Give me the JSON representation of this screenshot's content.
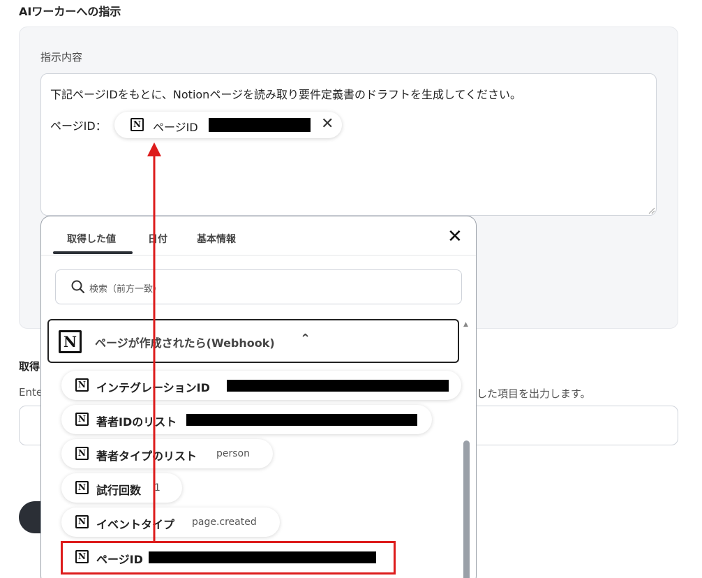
{
  "section_title": "AIワーカーへの指示",
  "instruction": {
    "label": "指示内容",
    "text": "下記ページIDをもとに、Notionページを読み取り要件定義書のドラフトを生成してください。",
    "page_id_label": "ページID：",
    "chip_label": "ページID",
    "chip_close": "✕"
  },
  "background": {
    "partial_title": "取得",
    "partial_desc_left": "Ente",
    "partial_desc_right": "した項目を出力します。"
  },
  "picker": {
    "tabs": [
      "取得した値",
      "日付",
      "基本情報"
    ],
    "close": "✕",
    "search_placeholder": "検索（前方一致）",
    "group_label": "ページが作成されたら(Webhook)",
    "group_chevron": "⌃",
    "items": [
      {
        "label": "インテグレーションID",
        "value": ""
      },
      {
        "label": "著者IDのリスト",
        "value": ""
      },
      {
        "label": "著者タイプのリスト",
        "value": "person"
      },
      {
        "label": "試行回数",
        "value": "1"
      },
      {
        "label": "イベントタイプ",
        "value": "page.created"
      },
      {
        "label": "ページID",
        "value": ""
      }
    ],
    "notion_icon_letter": "N"
  },
  "colors": {
    "highlight": "#dd1c1c",
    "arrow": "#dd1c1c",
    "card_bg": "#f5f6f8"
  }
}
